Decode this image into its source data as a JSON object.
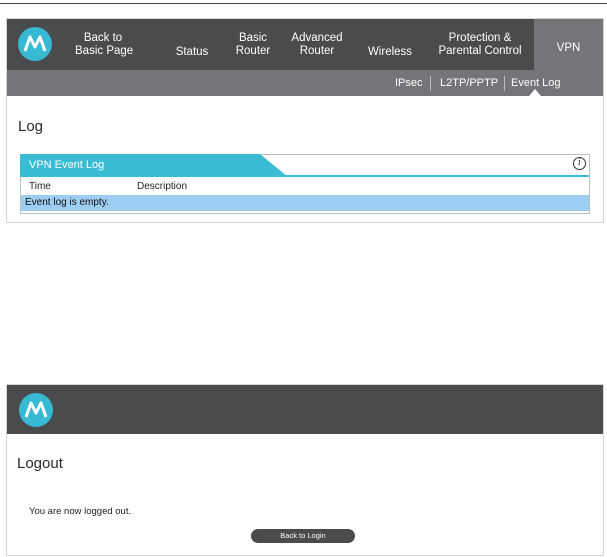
{
  "vpn_page": {
    "nav": {
      "back": "Back to\nBasic Page",
      "status": "Status",
      "basic_router": "Basic\nRouter",
      "advanced_router": "Advanced\nRouter",
      "wireless": "Wireless",
      "protection": "Protection &\nParental Control",
      "vpn": "VPN",
      "active": "VPN"
    },
    "subnav": {
      "ipsec": "IPsec",
      "l2tp": "L2TP/PPTP",
      "event_log": "Event Log",
      "active": "Event Log"
    },
    "title": "Log",
    "log_table": {
      "heading": "VPN Event Log",
      "columns": [
        "Time",
        "Description"
      ],
      "empty_message": "Event log is empty."
    },
    "info_icon": "i"
  },
  "logout_page": {
    "title": "Logout",
    "message": "You are now logged out.",
    "back_button": "Back to Login"
  },
  "colors": {
    "brand": "#37b9d3",
    "nav_bg": "#4a4b4d",
    "subnav_bg": "#737578",
    "empty_row": "#9ecdf2"
  },
  "icons": {
    "logo": "motorola-logo-icon",
    "info": "info-icon"
  }
}
